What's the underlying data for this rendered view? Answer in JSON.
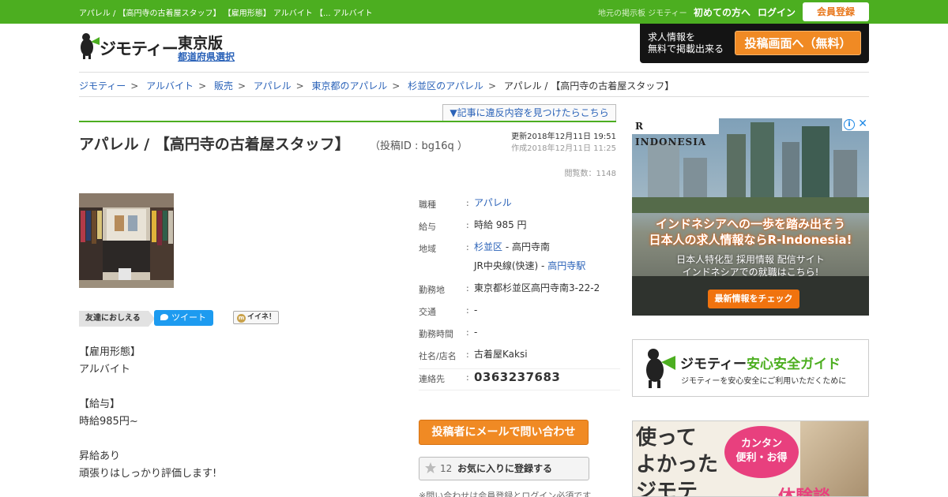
{
  "topbar": {
    "crumb": "アパレル / 【高円寺の古着屋スタッフ】 【雇用形態】 アルバイト 【... アルバイト",
    "tagline": "地元の掲示板 ジモティー",
    "first_time": "初めての方へ",
    "login": "ログイン",
    "register": "会員登録"
  },
  "header": {
    "logo_text": "ジモティー",
    "pref_name": "東京版",
    "pref_select": "都道府県選択",
    "post_promo": "求人情報を\n無料で掲載出来る",
    "post_button": "投稿画面へ（無料）"
  },
  "breadcrumb": {
    "items": [
      "ジモティー",
      "アルバイト",
      "販売",
      "アパレル",
      "東京都のアパレル",
      "杉並区のアパレル"
    ],
    "current": "アパレル / 【高円寺の古着屋スタッフ】",
    "separator": ">"
  },
  "report_link": "▼記事に違反内容を見つけたらこちら",
  "post": {
    "title": "アパレル / 【高円寺の古着屋スタッフ】",
    "post_id": "（投稿ID : bg16q ）",
    "updated": "更新2018年12月11日 19:51",
    "created": "作成2018年12月11日 11:25",
    "views": "閲覧数：1148"
  },
  "social": {
    "share_label": "友達におしえる",
    "tweet": "ツイート",
    "mixi": "イイネ！"
  },
  "description": [
    "【雇用形態】",
    "アルバイト",
    "",
    "【給与】",
    "時給985円~",
    "",
    "昇給あり",
    "頑張りはしっかり評価します!"
  ],
  "details": {
    "job_type_label": "職種",
    "job_type": "アパレル",
    "salary_label": "給与",
    "salary": "時給 985 円",
    "area_label": "地域",
    "area_ward": "杉並区",
    "area_town": " - 高円寺南",
    "area_line": "JR中央線(快速) - ",
    "area_station": "高円寺駅",
    "workplace_label": "勤務地",
    "workplace": "東京都杉並区高円寺南3-22-2",
    "transport_label": "交通",
    "transport": "-",
    "hours_label": "勤務時間",
    "hours": "-",
    "company_label": "社名/店名",
    "company": "古着屋Kaksi",
    "contact_label": "連絡先",
    "contact": "0363237683",
    "colon": ":"
  },
  "actions": {
    "mail_button": "投稿者にメールで問い合わせ",
    "fav_count": "12",
    "fav_label": "お気に入りに登録する",
    "note": "※問い合わせは会員登録とログイン必須です"
  },
  "ads": {
    "rindo_brand": "R INDONESIA",
    "rindo_head1": "インドネシアへの一歩を踏み出そう",
    "rindo_head2": "日本人の求人情報ならR-Indonesia!",
    "rindo_sub": "日本人特化型 採用情報 配信サイト\nインドネシアでの就職はこちら!",
    "rindo_cta": "最新情報をチェック",
    "guide_brand": "ジモティー",
    "guide_title": "安心安全ガイド",
    "guide_sub": "ジモティーを安心安全にご利用いただくために",
    "promo_big": "使って\nよかった\nジモテ",
    "promo_bubble": "カンタン\n便利・お得",
    "promo_stamp": "体験談"
  },
  "colors": {
    "brand_green": "#4cae20",
    "accent_orange": "#f08a24",
    "link_blue": "#2a62b8"
  }
}
